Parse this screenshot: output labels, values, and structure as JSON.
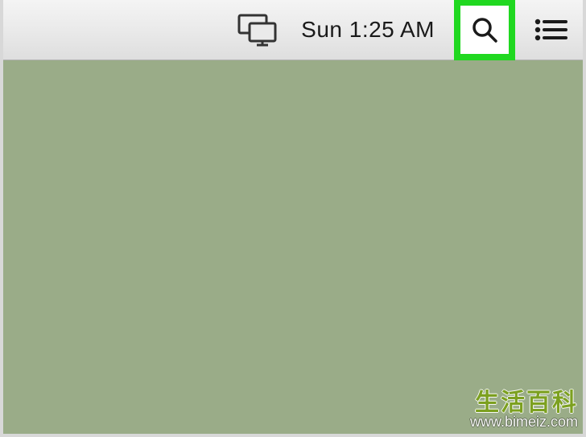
{
  "menubar": {
    "clock": "Sun 1:25 AM",
    "icons": {
      "displays": "displays-icon",
      "search": "search-icon",
      "list": "list-icon"
    }
  },
  "watermark": {
    "brand": "生活百科",
    "url": "www.bimeiz.com"
  }
}
